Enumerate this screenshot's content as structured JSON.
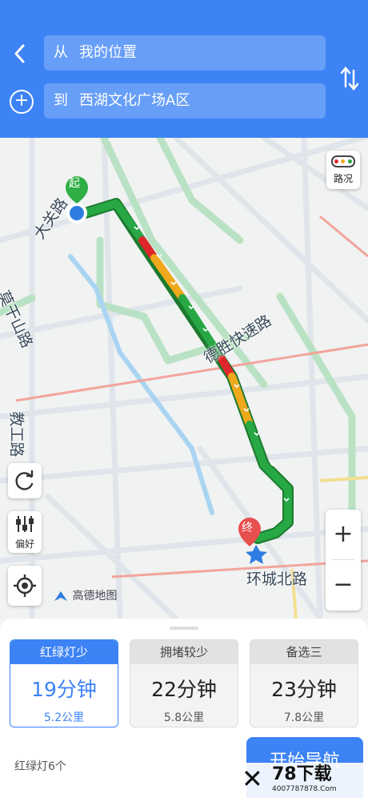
{
  "header": {
    "from_prefix": "从",
    "from_value": "我的位置",
    "to_prefix": "到",
    "to_value": "西湖文化广场A区"
  },
  "map": {
    "road_labels": {
      "daguan": "大关路",
      "moganshan": "莫干山路",
      "desheng": "德胜快速路",
      "jiaogong": "教工路",
      "huancheng": "环城北路"
    },
    "start_marker": "起",
    "end_marker": "终",
    "traffic_label": "路况",
    "preference_label": "偏好",
    "zoom_in": "+",
    "zoom_out": "−",
    "logo_text": "高德地图",
    "icons": [
      "back-icon",
      "add-icon",
      "swap-icon",
      "traffic-light-icon",
      "refresh-icon",
      "preference-icon",
      "locate-icon"
    ],
    "route_colors": {
      "smooth": "#27a844",
      "slow": "#f0a81c",
      "congested": "#e0262b"
    }
  },
  "routes": [
    {
      "tag": "红绿灯少",
      "time": "19分钟",
      "distance": "5.2公里",
      "selected": true
    },
    {
      "tag": "拥堵较少",
      "time": "22分钟",
      "distance": "5.8公里",
      "selected": false
    },
    {
      "tag": "备选三",
      "time": "23分钟",
      "distance": "7.8公里",
      "selected": false
    }
  ],
  "footer": {
    "traffic_lights": "红绿灯6个",
    "start_button": "开始导航"
  },
  "watermark": {
    "title": "78下载",
    "url": "4007787878.Com"
  }
}
